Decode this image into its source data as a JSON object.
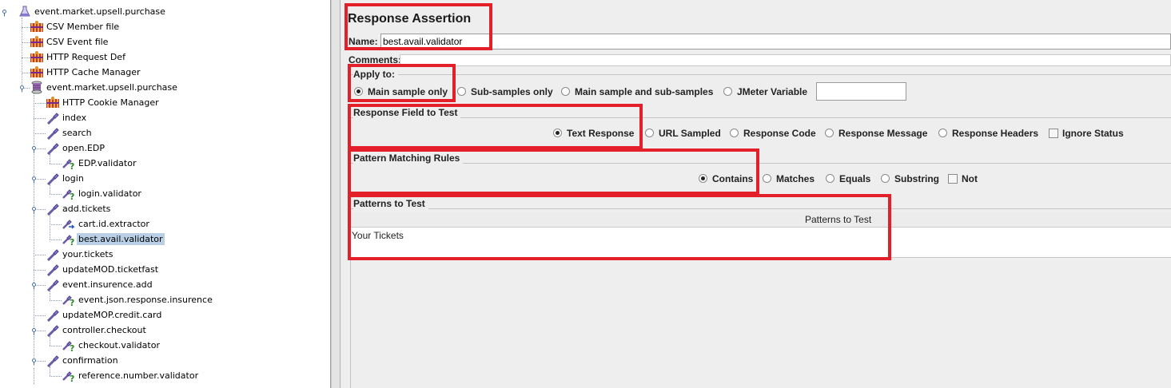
{
  "tree": {
    "items": [
      {
        "label": "event.market.upsell.purchase",
        "icon": "test-plan-flask-icon",
        "level": 0
      },
      {
        "label": "CSV Member file",
        "icon": "config-element-icon",
        "level": 1
      },
      {
        "label": "CSV Event file",
        "icon": "config-element-icon",
        "level": 1
      },
      {
        "label": "HTTP Request Def",
        "icon": "config-element-icon",
        "level": 1
      },
      {
        "label": "HTTP Cache Manager",
        "icon": "config-element-icon",
        "level": 1
      },
      {
        "label": "event.market.upsell.purchase",
        "icon": "thread-group-spool-icon",
        "level": 1
      },
      {
        "label": "HTTP Cookie Manager",
        "icon": "config-element-icon",
        "level": 2
      },
      {
        "label": "index",
        "icon": "sampler-pipette-icon",
        "level": 2
      },
      {
        "label": "search",
        "icon": "sampler-pipette-icon",
        "level": 2
      },
      {
        "label": "open.EDP",
        "icon": "sampler-pipette-icon",
        "level": 2
      },
      {
        "label": "EDP.validator",
        "icon": "assertion-icon",
        "level": 3
      },
      {
        "label": "login",
        "icon": "sampler-pipette-icon",
        "level": 2
      },
      {
        "label": "login.validator",
        "icon": "assertion-icon",
        "level": 3
      },
      {
        "label": "add.tickets",
        "icon": "sampler-pipette-icon",
        "level": 2
      },
      {
        "label": "cart.id.extractor",
        "icon": "extractor-icon",
        "level": 3
      },
      {
        "label": "best.avail.validator",
        "icon": "assertion-icon",
        "level": 3
      },
      {
        "label": "your.tickets",
        "icon": "sampler-pipette-icon",
        "level": 2
      },
      {
        "label": "updateMOD.ticketfast",
        "icon": "sampler-pipette-icon",
        "level": 2
      },
      {
        "label": "event.insurence.add",
        "icon": "sampler-pipette-icon",
        "level": 2
      },
      {
        "label": "event.json.response.insurence",
        "icon": "assertion-icon",
        "level": 3
      },
      {
        "label": "updateMOP.credit.card",
        "icon": "sampler-pipette-icon",
        "level": 2
      },
      {
        "label": "controller.checkout",
        "icon": "sampler-pipette-icon",
        "level": 2
      },
      {
        "label": "checkout.validator",
        "icon": "assertion-icon",
        "level": 3
      },
      {
        "label": "confirmation",
        "icon": "sampler-pipette-icon",
        "level": 2
      },
      {
        "label": "reference.number.validator",
        "icon": "assertion-icon",
        "level": 3
      }
    ],
    "selected_label": "best.avail.validator"
  },
  "panel": {
    "title": "Response Assertion",
    "name_label": "Name:",
    "name_value": "best.avail.validator",
    "comments_label": "Comments:",
    "apply_to": {
      "legend": "Apply to:",
      "options": [
        "Main sample only",
        "Sub-samples only",
        "Main sample and sub-samples",
        "JMeter Variable"
      ],
      "selected": "Main sample only",
      "variable_value": ""
    },
    "response_field": {
      "legend": "Response Field to Test",
      "options": [
        "Text Response",
        "URL Sampled",
        "Response Code",
        "Response Message",
        "Response Headers"
      ],
      "selected": "Text Response",
      "ignore_status_label": "Ignore Status",
      "ignore_status_checked": false
    },
    "pattern_rules": {
      "legend": "Pattern Matching Rules",
      "options": [
        "Contains",
        "Matches",
        "Equals",
        "Substring"
      ],
      "selected": "Contains",
      "not_label": "Not",
      "not_checked": false
    },
    "patterns": {
      "legend": "Patterns to Test",
      "column_header": "Patterns to Test",
      "rows": [
        "Your Tickets"
      ]
    }
  },
  "colors": {
    "highlight": "#e3202a",
    "selection": "#b8cfe5"
  }
}
